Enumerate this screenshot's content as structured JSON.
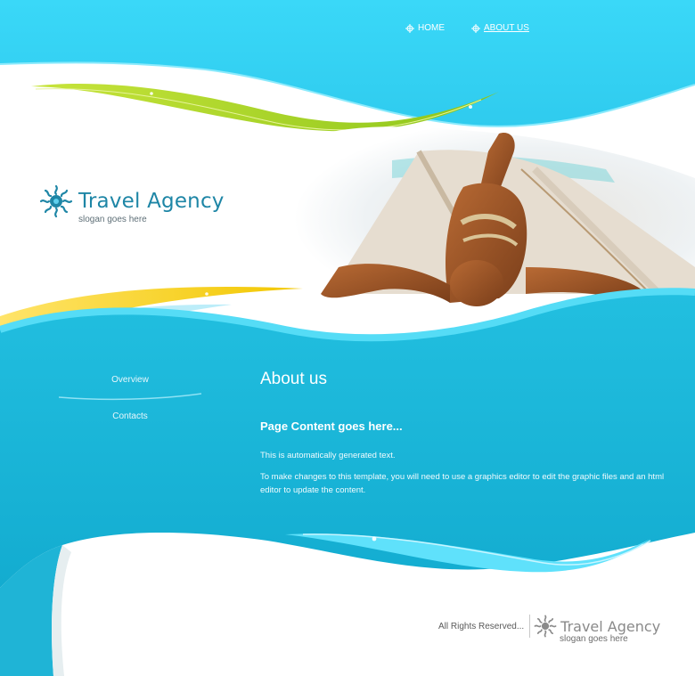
{
  "nav": {
    "items": [
      {
        "label": "HOME"
      },
      {
        "label": "ABOUT US"
      }
    ]
  },
  "header": {
    "title": "Travel Agency",
    "slogan": "slogan goes here"
  },
  "sidebar": {
    "items": [
      {
        "label": "Overview"
      },
      {
        "label": "Contacts"
      }
    ]
  },
  "main": {
    "heading": "About us",
    "subheading": "Page Content goes here...",
    "paragraph1": "This is automatically generated text.",
    "paragraph2": "To make changes to this template, you will need to use a graphics editor to edit the graphic files and an html editor to update the content."
  },
  "footer": {
    "rights": "All Rights Reserved...",
    "title": "Travel Agency",
    "slogan": "slogan goes here"
  },
  "colors": {
    "sky": "#3ad6f7",
    "teal": "#1ab3d3",
    "lime": "#a6d21a",
    "yellow": "#f5d000",
    "brand": "#1e86a6"
  },
  "icons": {
    "logo": "sun-icon",
    "nav_bullet": "crosshair-icon"
  }
}
